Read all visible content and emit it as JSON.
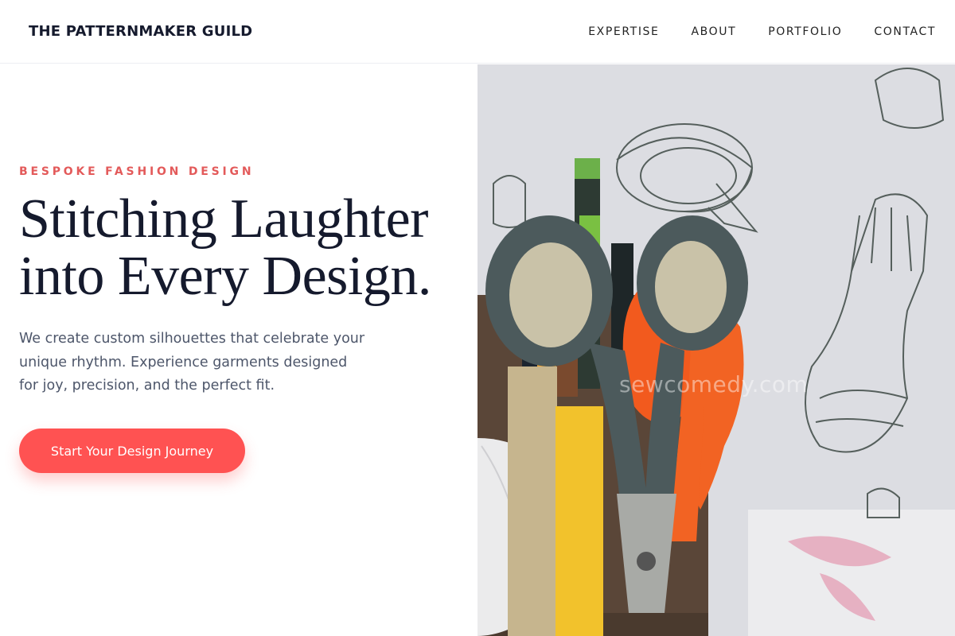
{
  "brand": {
    "name": "THE PATTERNMAKER GUILD"
  },
  "nav": {
    "items": [
      {
        "label": "EXPERTISE"
      },
      {
        "label": "ABOUT"
      },
      {
        "label": "PORTFOLIO"
      },
      {
        "label": "CONTACT"
      }
    ]
  },
  "hero": {
    "eyebrow": "BESPOKE FASHION DESIGN",
    "headline_line1": "Stitching Laughter",
    "headline_line2": "into Every Design.",
    "lede_line1": "We create custom silhouettes that celebrate your",
    "lede_line2": "unique rhythm. Experience garments designed",
    "lede_line3": "for joy, precision, and the perfect fit.",
    "cta_label": "Start Your Design Journey",
    "watermark": "sewcomedy.com"
  },
  "colors": {
    "accent": "#ff5252",
    "eyebrow": "#e35a5a",
    "headline": "#151a2d",
    "body_text": "#4d566a"
  },
  "image": {
    "subject": "scissors-and-pencils-in-holder-icon"
  }
}
